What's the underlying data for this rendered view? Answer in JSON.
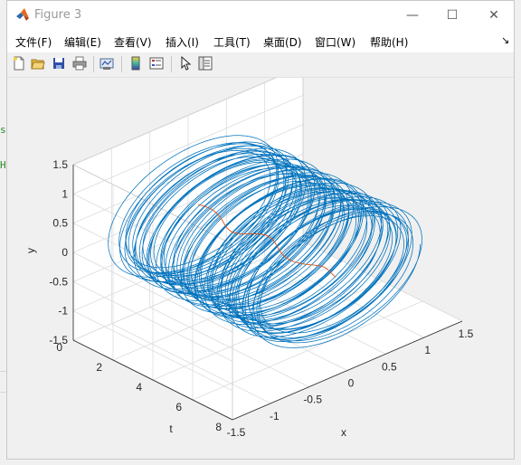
{
  "window": {
    "title": "Figure 3",
    "minimize_glyph": "—",
    "maximize_glyph": "☐",
    "close_glyph": "✕"
  },
  "menu": {
    "items": [
      "文件(F)",
      "编辑(E)",
      "查看(V)",
      "插入(I)",
      "工具(T)",
      "桌面(D)",
      "窗口(W)",
      "帮助(H)"
    ],
    "dock_glyph": "↘"
  },
  "toolbar": {
    "icons": [
      "new-figure-icon",
      "open-file-icon",
      "save-icon",
      "print-icon",
      "link-plot-icon",
      "colorbar-icon",
      "legend-icon",
      "pointer-icon",
      "property-editor-icon"
    ]
  },
  "background_fragments": [
    "s",
    "H"
  ],
  "chart_data": {
    "type": "line",
    "title": "",
    "xlabel": "x",
    "ylabel": "y",
    "zlabel": "t",
    "xlim": [
      -1.5,
      1.5
    ],
    "ylim": [
      -1.5,
      1.5
    ],
    "tlim": [
      0,
      8
    ],
    "x_ticks": [
      "-1.5",
      "-1",
      "-0.5",
      "0",
      "0.5",
      "1",
      "1.5"
    ],
    "y_ticks": [
      "-1.5",
      "-1",
      "-0.5",
      "0",
      "0.5",
      "1",
      "1.5"
    ],
    "t_ticks": [
      "0",
      "2",
      "4",
      "6",
      "8"
    ],
    "grid": true,
    "series": [
      {
        "color": "#0072bd",
        "description": "spiral trajectory winding around the t-axis, radius about 0.95–1.1",
        "t_range": [
          0.3,
          7.6
        ],
        "radius_range": [
          0.95,
          1.1
        ],
        "turns": 70
      },
      {
        "color": "#d95319",
        "description": "thin central axis line along t",
        "t_range": [
          0.5,
          7.6
        ],
        "x": 0,
        "y": 0
      }
    ]
  }
}
